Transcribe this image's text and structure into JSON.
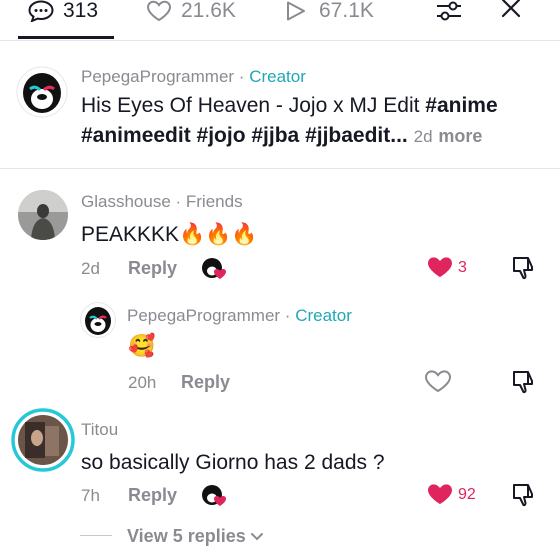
{
  "header": {
    "comments_count": "313",
    "likes_count": "21.6K",
    "views_count": "67.1K"
  },
  "caption": {
    "author": "PepegaProgrammer",
    "separator": " · ",
    "badge": "Creator",
    "text_plain": "His Eyes Of Heaven - Jojo x MJ Edit ",
    "tag1": "#anime",
    "tags_line2": "#animeedit #jojo #jjba #jjbaedit...",
    "time": "2d",
    "more_label": "more"
  },
  "comments": [
    {
      "author": "Glasshouse",
      "relation": " · Friends",
      "text": "PEAKKKK",
      "emoji": "🔥🔥🔥",
      "time": "2d",
      "reply_label": "Reply",
      "likes": "3",
      "liked": true
    },
    {
      "author": "PepegaProgrammer",
      "relation": " · ",
      "badge": "Creator",
      "emoji": "🥰",
      "time": "20h",
      "reply_label": "Reply",
      "liked": false
    },
    {
      "author": "Titou",
      "text": "so basically Giorno has 2 dads ?",
      "time": "7h",
      "reply_label": "Reply",
      "likes": "92",
      "liked": true,
      "view_replies_label": "View 5 replies"
    }
  ],
  "colors": {
    "creator": "#20a8b8",
    "like_red": "#e0245e",
    "muted": "#8a8b91",
    "text": "#161823"
  },
  "icons": [
    "comment-icon",
    "heart-icon",
    "play-icon",
    "filter-icon",
    "close-icon",
    "dislike-icon",
    "chevron-down-icon"
  ]
}
